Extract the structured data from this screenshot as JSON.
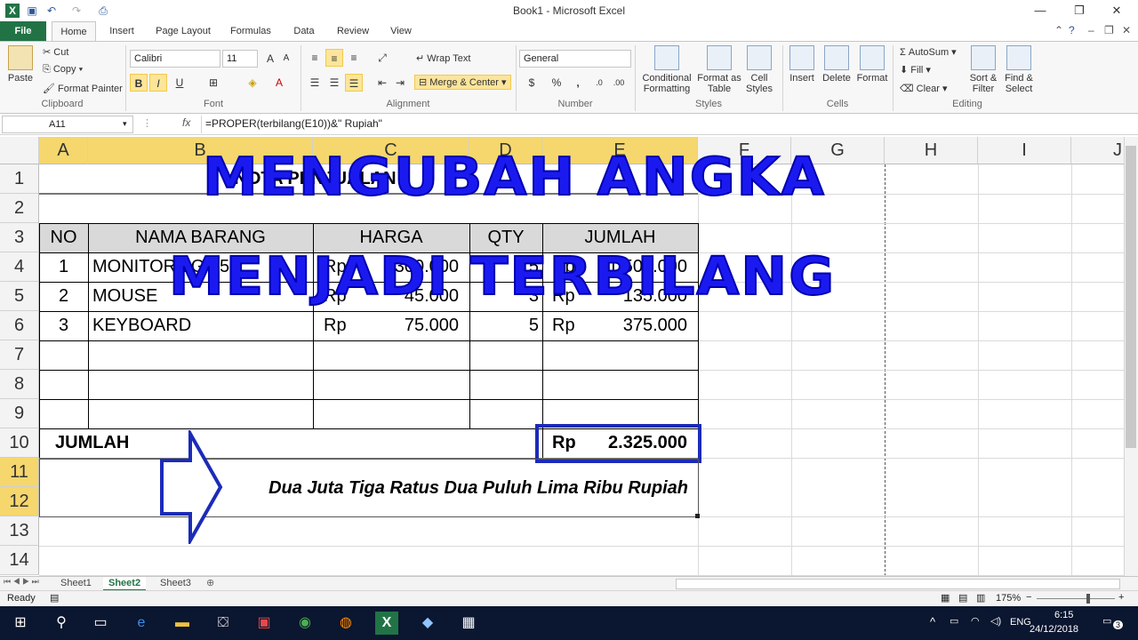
{
  "window": {
    "title": "Book1  -  Microsoft Excel"
  },
  "tabs": [
    "File",
    "Home",
    "Insert",
    "Page Layout",
    "Formulas",
    "Data",
    "Review",
    "View"
  ],
  "ribbon": {
    "clipboard": {
      "paste": "Paste",
      "cut": "Cut",
      "copy": "Copy",
      "format_painter": "Format Painter",
      "label": "Clipboard"
    },
    "font": {
      "name": "Calibri",
      "size": "11",
      "label": "Font",
      "bold": "B",
      "italic": "I",
      "underline": "U"
    },
    "alignment": {
      "wrap_text": "Wrap Text",
      "merge_center": "Merge & Center",
      "label": "Alignment"
    },
    "number": {
      "format": "General",
      "percent": "%",
      "comma": ",",
      "label": "Number"
    },
    "styles": {
      "conditional": "Conditional Formatting",
      "format_table": "Format as Table",
      "cell_styles": "Cell Styles",
      "label": "Styles"
    },
    "cells": {
      "insert": "Insert",
      "delete": "Delete",
      "format": "Format",
      "label": "Cells"
    },
    "editing": {
      "autosum": "AutoSum",
      "fill": "Fill",
      "clear": "Clear",
      "sort_filter": "Sort & Filter",
      "find_select": "Find & Select",
      "label": "Editing"
    }
  },
  "formula_bar": {
    "name_box": "A11",
    "fx": "fx",
    "formula": "=PROPER(terbilang(E10))&\" Rupiah\""
  },
  "grid": {
    "columns": [
      "A",
      "B",
      "C",
      "D",
      "E",
      "F",
      "G",
      "H",
      "I",
      "J"
    ],
    "rows": [
      "1",
      "2",
      "3",
      "4",
      "5",
      "6",
      "7",
      "8",
      "9",
      "10",
      "11",
      "12",
      "13",
      "14"
    ],
    "title_cell": "NOTA PENJUALAN",
    "headers": {
      "no": "NO",
      "nama": "NAMA BARANG",
      "harga": "HARGA",
      "qty": "QTY",
      "jumlah": "JUMLAH"
    },
    "items": [
      {
        "no": "1",
        "nama": "MONITOR LG 15\"",
        "rp1": "Rp",
        "harga": "300.000",
        "qty": "5",
        "rp2": "Rp",
        "jumlah": "1.500.000"
      },
      {
        "no": "2",
        "nama": "MOUSE",
        "rp1": "Rp",
        "harga": "45.000",
        "qty": "3",
        "rp2": "Rp",
        "jumlah": "135.000"
      },
      {
        "no": "3",
        "nama": "KEYBOARD",
        "rp1": "Rp",
        "harga": "75.000",
        "qty": "5",
        "rp2": "Rp",
        "jumlah": "375.000"
      }
    ],
    "total_label": "JUMLAH",
    "total_rp": "Rp",
    "total_value": "2.325.000",
    "terbilang": "Dua Juta Tiga Ratus Dua Puluh Lima Ribu Rupiah"
  },
  "overlay": {
    "line1": "MENGUBAH ANGKA",
    "line2": "MENJADI TERBILANG",
    "color": "#1a1af0"
  },
  "sheets": [
    "Sheet1",
    "Sheet2",
    "Sheet3"
  ],
  "status": {
    "ready": "Ready",
    "zoom": "175%"
  },
  "taskbar": {
    "lang": "ENG",
    "time": "6:15",
    "date": "24/12/2018",
    "notif": "3"
  }
}
